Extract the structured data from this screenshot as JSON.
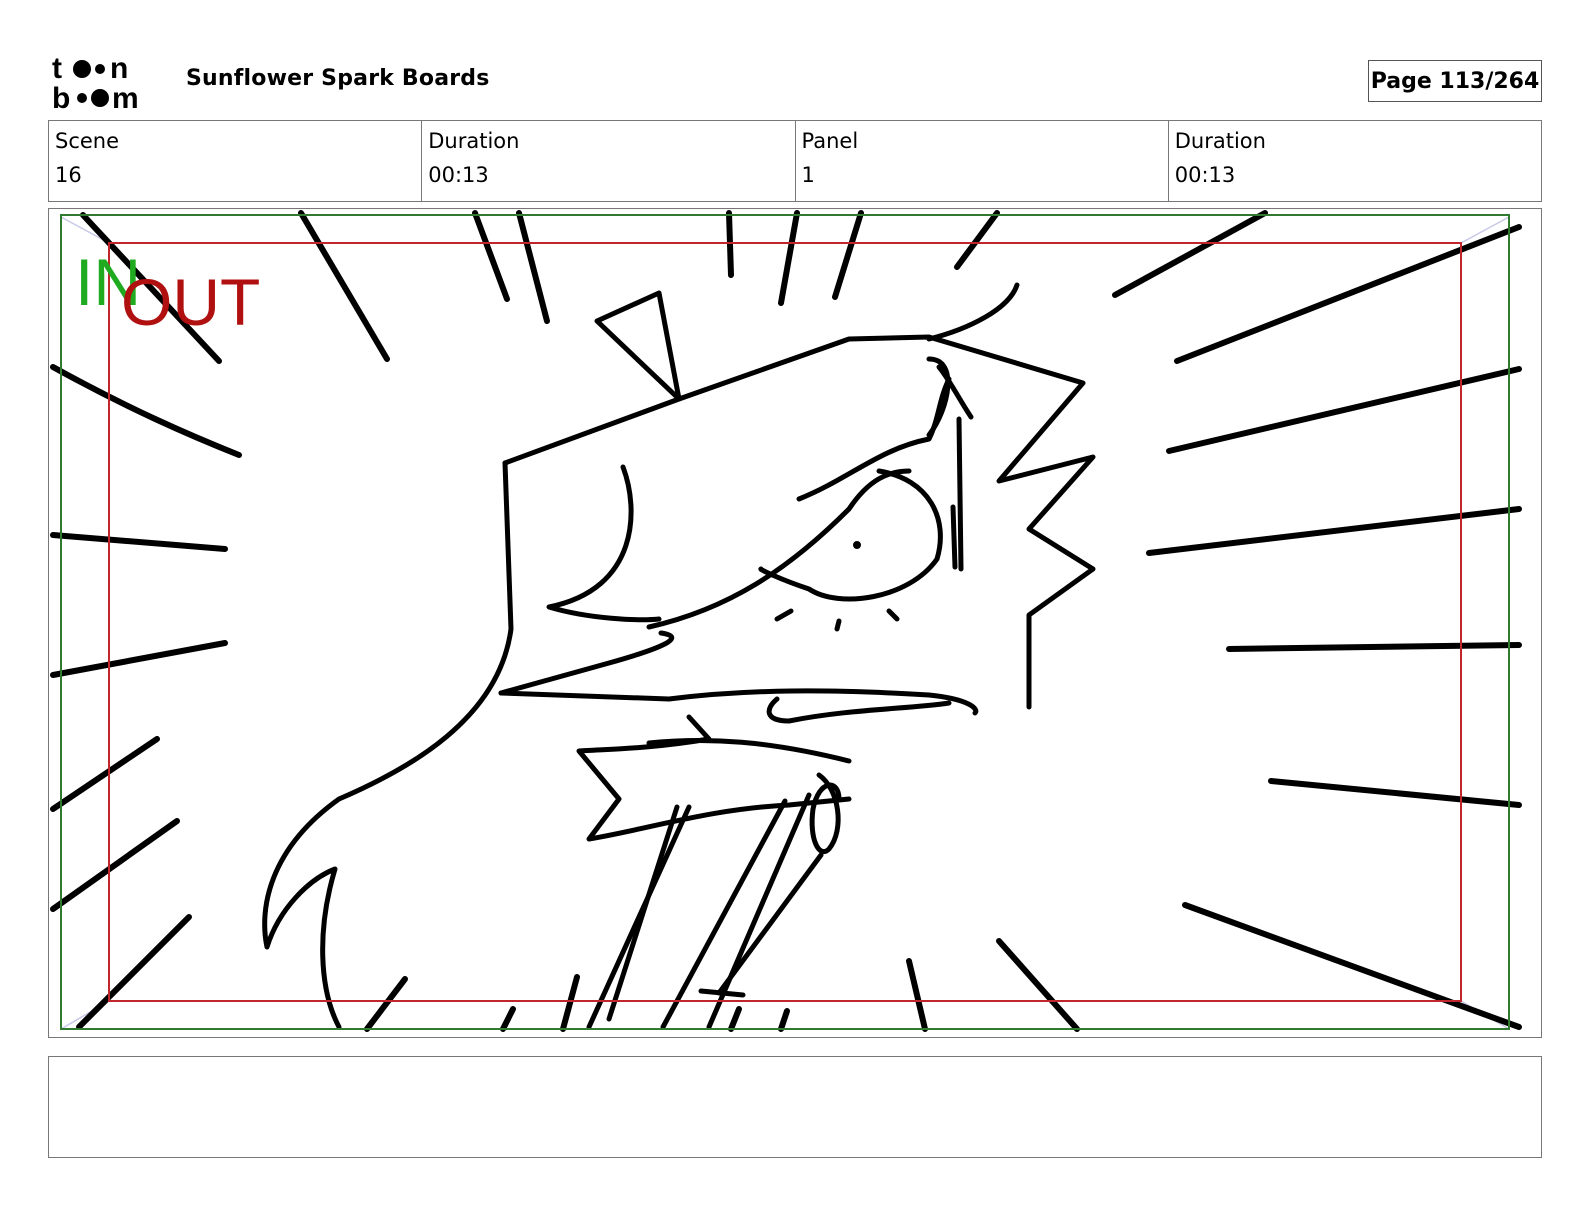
{
  "header": {
    "logo_text": "toon boom",
    "project_title": "Sunflower Spark Boards",
    "page_label": "Page 113/264"
  },
  "info": {
    "scene_label": "Scene",
    "scene_value": "16",
    "scene_duration_label": "Duration",
    "scene_duration_value": "00:13",
    "panel_label": "Panel",
    "panel_value": "1",
    "panel_duration_label": "Duration",
    "panel_duration_value": "00:13"
  },
  "panel": {
    "in_marker": "IN",
    "out_marker": "OUT",
    "in_color": "#1faa1f",
    "out_color": "#b01010",
    "safe_frame_color": "#2f7a2f",
    "camera_frame_color": "#c0262b"
  },
  "notes": {
    "text": ""
  }
}
